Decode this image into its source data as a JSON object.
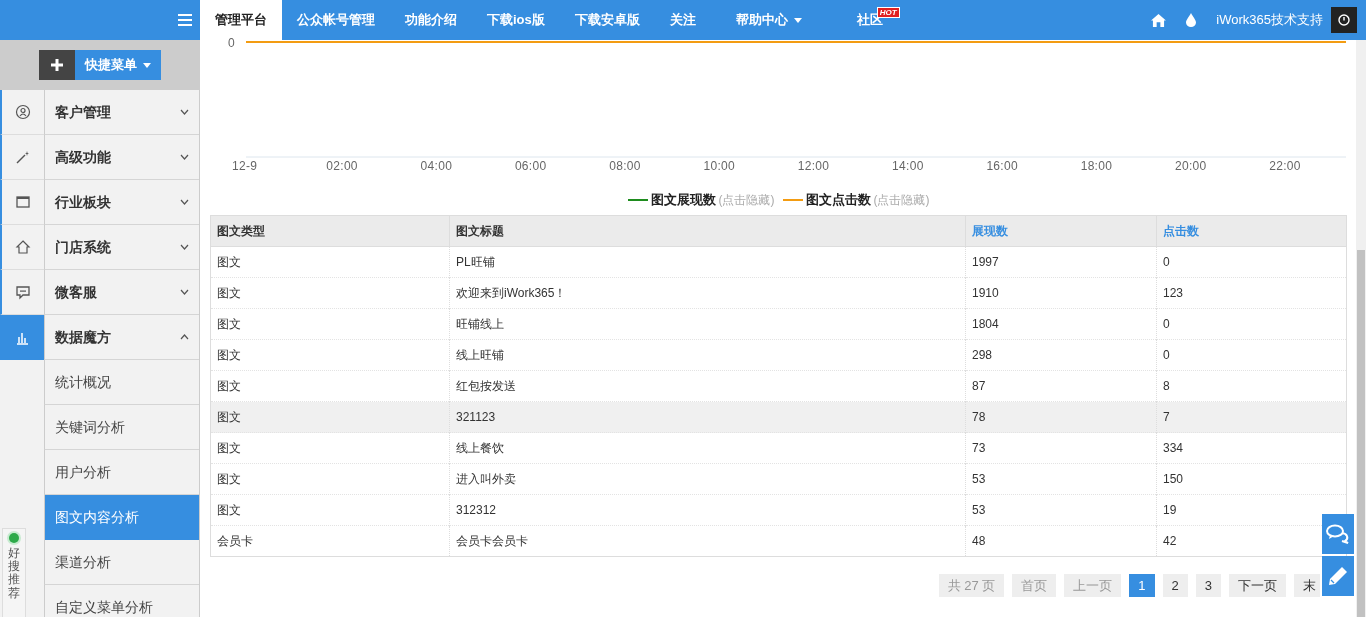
{
  "top_nav": {
    "items": [
      {
        "label": "管理平台",
        "selected": true
      },
      {
        "label": "公众帐号管理",
        "selected": false
      },
      {
        "label": "功能介绍",
        "selected": false
      },
      {
        "label": "下载ios版",
        "selected": false
      },
      {
        "label": "下载安卓版",
        "selected": false
      },
      {
        "label": "关注",
        "selected": false
      },
      {
        "label": "帮助中心",
        "selected": false,
        "dropdown": true
      },
      {
        "label": "社区",
        "selected": false,
        "badge": "HOT"
      }
    ],
    "user": "iWork365技术支持"
  },
  "quick_menu": {
    "label": "快捷菜单"
  },
  "sidebar": {
    "groups": [
      {
        "label": "客户管理",
        "expanded": false
      },
      {
        "label": "高级功能",
        "expanded": false
      },
      {
        "label": "行业板块",
        "expanded": false
      },
      {
        "label": "门店系统",
        "expanded": false
      },
      {
        "label": "微客服",
        "expanded": false
      },
      {
        "label": "数据魔方",
        "expanded": true,
        "children": [
          {
            "label": "统计概况",
            "selected": false
          },
          {
            "label": "关键词分析",
            "selected": false
          },
          {
            "label": "用户分析",
            "selected": false
          },
          {
            "label": "图文内容分析",
            "selected": true
          },
          {
            "label": "渠道分析",
            "selected": false
          },
          {
            "label": "自定义菜单分析",
            "selected": false
          }
        ]
      }
    ]
  },
  "side_widget": {
    "label": "好搜推荐"
  },
  "chart": {
    "y_label": "0",
    "x_labels": [
      "12-9",
      "02:00",
      "04:00",
      "06:00",
      "08:00",
      "10:00",
      "12:00",
      "14:00",
      "16:00",
      "18:00",
      "20:00",
      "22:00"
    ],
    "legend": [
      {
        "label": "图文展现数",
        "hint": "(点击隐藏)",
        "color": "#1e8c1e"
      },
      {
        "label": "图文点击数",
        "hint": "(点击隐藏)",
        "color": "#f39c12"
      }
    ]
  },
  "table": {
    "columns": [
      {
        "label": "图文类型",
        "sortable": false
      },
      {
        "label": "图文标题",
        "sortable": false
      },
      {
        "label": "展现数",
        "sortable": true
      },
      {
        "label": "点击数",
        "sortable": true
      }
    ],
    "rows": [
      {
        "cells": [
          "图文",
          "PL旺铺",
          "1997",
          "0"
        ],
        "hovered": false
      },
      {
        "cells": [
          "图文",
          "欢迎来到iWork365！",
          "1910",
          "123"
        ],
        "hovered": false
      },
      {
        "cells": [
          "图文",
          "旺铺线上",
          "1804",
          "0"
        ],
        "hovered": false
      },
      {
        "cells": [
          "图文",
          "线上旺铺",
          "298",
          "0"
        ],
        "hovered": false
      },
      {
        "cells": [
          "图文",
          "红包按发送",
          "87",
          "8"
        ],
        "hovered": false
      },
      {
        "cells": [
          "图文",
          "321123",
          "78",
          "7"
        ],
        "hovered": true
      },
      {
        "cells": [
          "图文",
          "线上餐饮",
          "73",
          "334"
        ],
        "hovered": false
      },
      {
        "cells": [
          "图文",
          "进入叫外卖",
          "53",
          "150"
        ],
        "hovered": false
      },
      {
        "cells": [
          "图文",
          "312312",
          "53",
          "19"
        ],
        "hovered": false
      },
      {
        "cells": [
          "会员卡",
          "会员卡会员卡",
          "48",
          "42"
        ],
        "hovered": false
      }
    ]
  },
  "pagination": [
    {
      "label": "共 27 页",
      "kind": "info",
      "selected": false
    },
    {
      "label": "首页",
      "kind": "nav",
      "disabled": true,
      "selected": false
    },
    {
      "label": "上一页",
      "kind": "nav",
      "disabled": true,
      "selected": false
    },
    {
      "label": "1",
      "kind": "page",
      "selected": true
    },
    {
      "label": "2",
      "kind": "page",
      "selected": false
    },
    {
      "label": "3",
      "kind": "page",
      "selected": false
    },
    {
      "label": "下一页",
      "kind": "nav",
      "disabled": false,
      "selected": false
    },
    {
      "label": "末",
      "kind": "nav",
      "disabled": false,
      "selected": false
    }
  ]
}
